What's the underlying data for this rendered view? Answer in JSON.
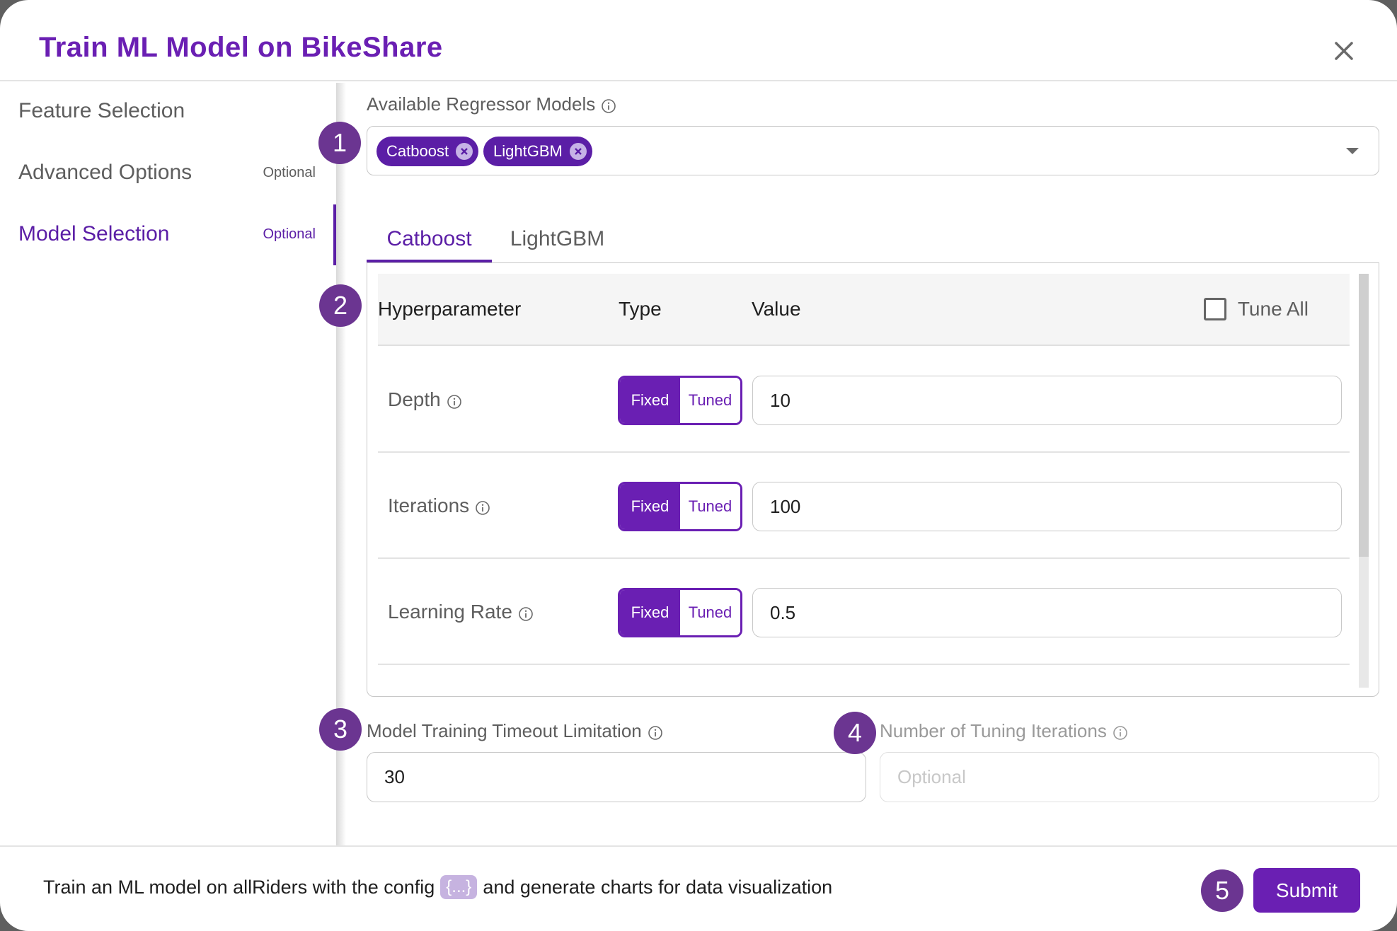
{
  "dialog": {
    "title": "Train ML Model on BikeShare",
    "close_icon": "close-icon"
  },
  "sidebar": {
    "items": [
      {
        "label": "Feature Selection",
        "tag": "",
        "active": false
      },
      {
        "label": "Advanced Options",
        "tag": "Optional",
        "active": false
      },
      {
        "label": "Model Selection",
        "tag": "Optional",
        "active": true
      }
    ]
  },
  "models_field": {
    "label": "Available Regressor Models",
    "info_icon": "info-icon",
    "selected": [
      "Catboost",
      "LightGBM"
    ],
    "dropdown_icon": "caret-down-icon"
  },
  "tabs": [
    {
      "label": "Catboost",
      "active": true
    },
    {
      "label": "LightGBM",
      "active": false
    }
  ],
  "table": {
    "headers": {
      "hyperparameter": "Hyperparameter",
      "type": "Type",
      "value": "Value"
    },
    "tune_all": {
      "label": "Tune All",
      "checked": false
    },
    "rows": [
      {
        "name": "Depth",
        "type_options": [
          "Fixed",
          "Tuned"
        ],
        "type_selected": "Fixed",
        "value": "10"
      },
      {
        "name": "Iterations",
        "type_options": [
          "Fixed",
          "Tuned"
        ],
        "type_selected": "Fixed",
        "value": "100"
      },
      {
        "name": "Learning Rate",
        "type_options": [
          "Fixed",
          "Tuned"
        ],
        "type_selected": "Fixed",
        "value": "0.5"
      }
    ]
  },
  "timeout_field": {
    "label": "Model Training Timeout Limitation",
    "value": "30"
  },
  "tuning_iterations_field": {
    "label": "Number of Tuning Iterations",
    "placeholder": "Optional",
    "value": "",
    "disabled": true
  },
  "footer": {
    "text_before": "Train an ML model on allRiders with the config",
    "config_chip": "{...}",
    "text_after": "and generate charts for data visualization",
    "submit_label": "Submit"
  },
  "annotations": [
    "1",
    "2",
    "3",
    "4",
    "5"
  ],
  "colors": {
    "accent": "#6a1fb3",
    "accent_dark": "#5b1ea6",
    "badge": "#6b3591",
    "chip_light": "#c6b3e0"
  }
}
